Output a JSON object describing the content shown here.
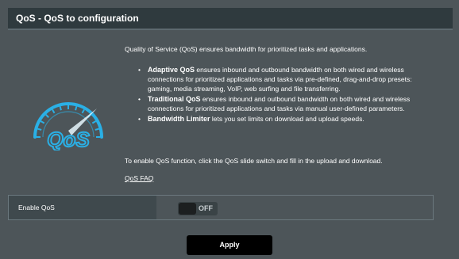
{
  "header": {
    "title": "QoS - QoS to configuration"
  },
  "description": {
    "intro": "Quality of Service (QoS) ensures bandwidth for prioritized tasks and applications.",
    "bullets": [
      {
        "name": "Adaptive QoS",
        "text": " ensures inbound and outbound bandwidth on both wired and wireless connections for prioritized applications and tasks via pre-defined, drag-and-drop presets: gaming, media streaming, VoIP, web surfing and file transferring."
      },
      {
        "name": "Traditional QoS",
        "text": " ensures inbound and outbound bandwidth on both wired and wireless connections for prioritized applications and tasks via manual user-defined parameters."
      },
      {
        "name": "Bandwidth Limiter",
        "text": " lets you set limits on download and upload speeds."
      }
    ],
    "enable_instructions": "To enable QoS function, click the QoS slide switch and fill in the upload and download.",
    "faq_link": "QoS FAQ"
  },
  "settings": {
    "enable_qos_label": "Enable QoS",
    "enable_qos_state": "OFF"
  },
  "actions": {
    "apply_label": "Apply"
  },
  "logo": {
    "text": "QoS",
    "icon": "speedometer-qos-icon",
    "color": "#2ab0e6"
  },
  "colors": {
    "background": "#4d5559",
    "titlebar": "#2f3a3e",
    "accent": "#2ab0e6",
    "button": "#000000"
  }
}
